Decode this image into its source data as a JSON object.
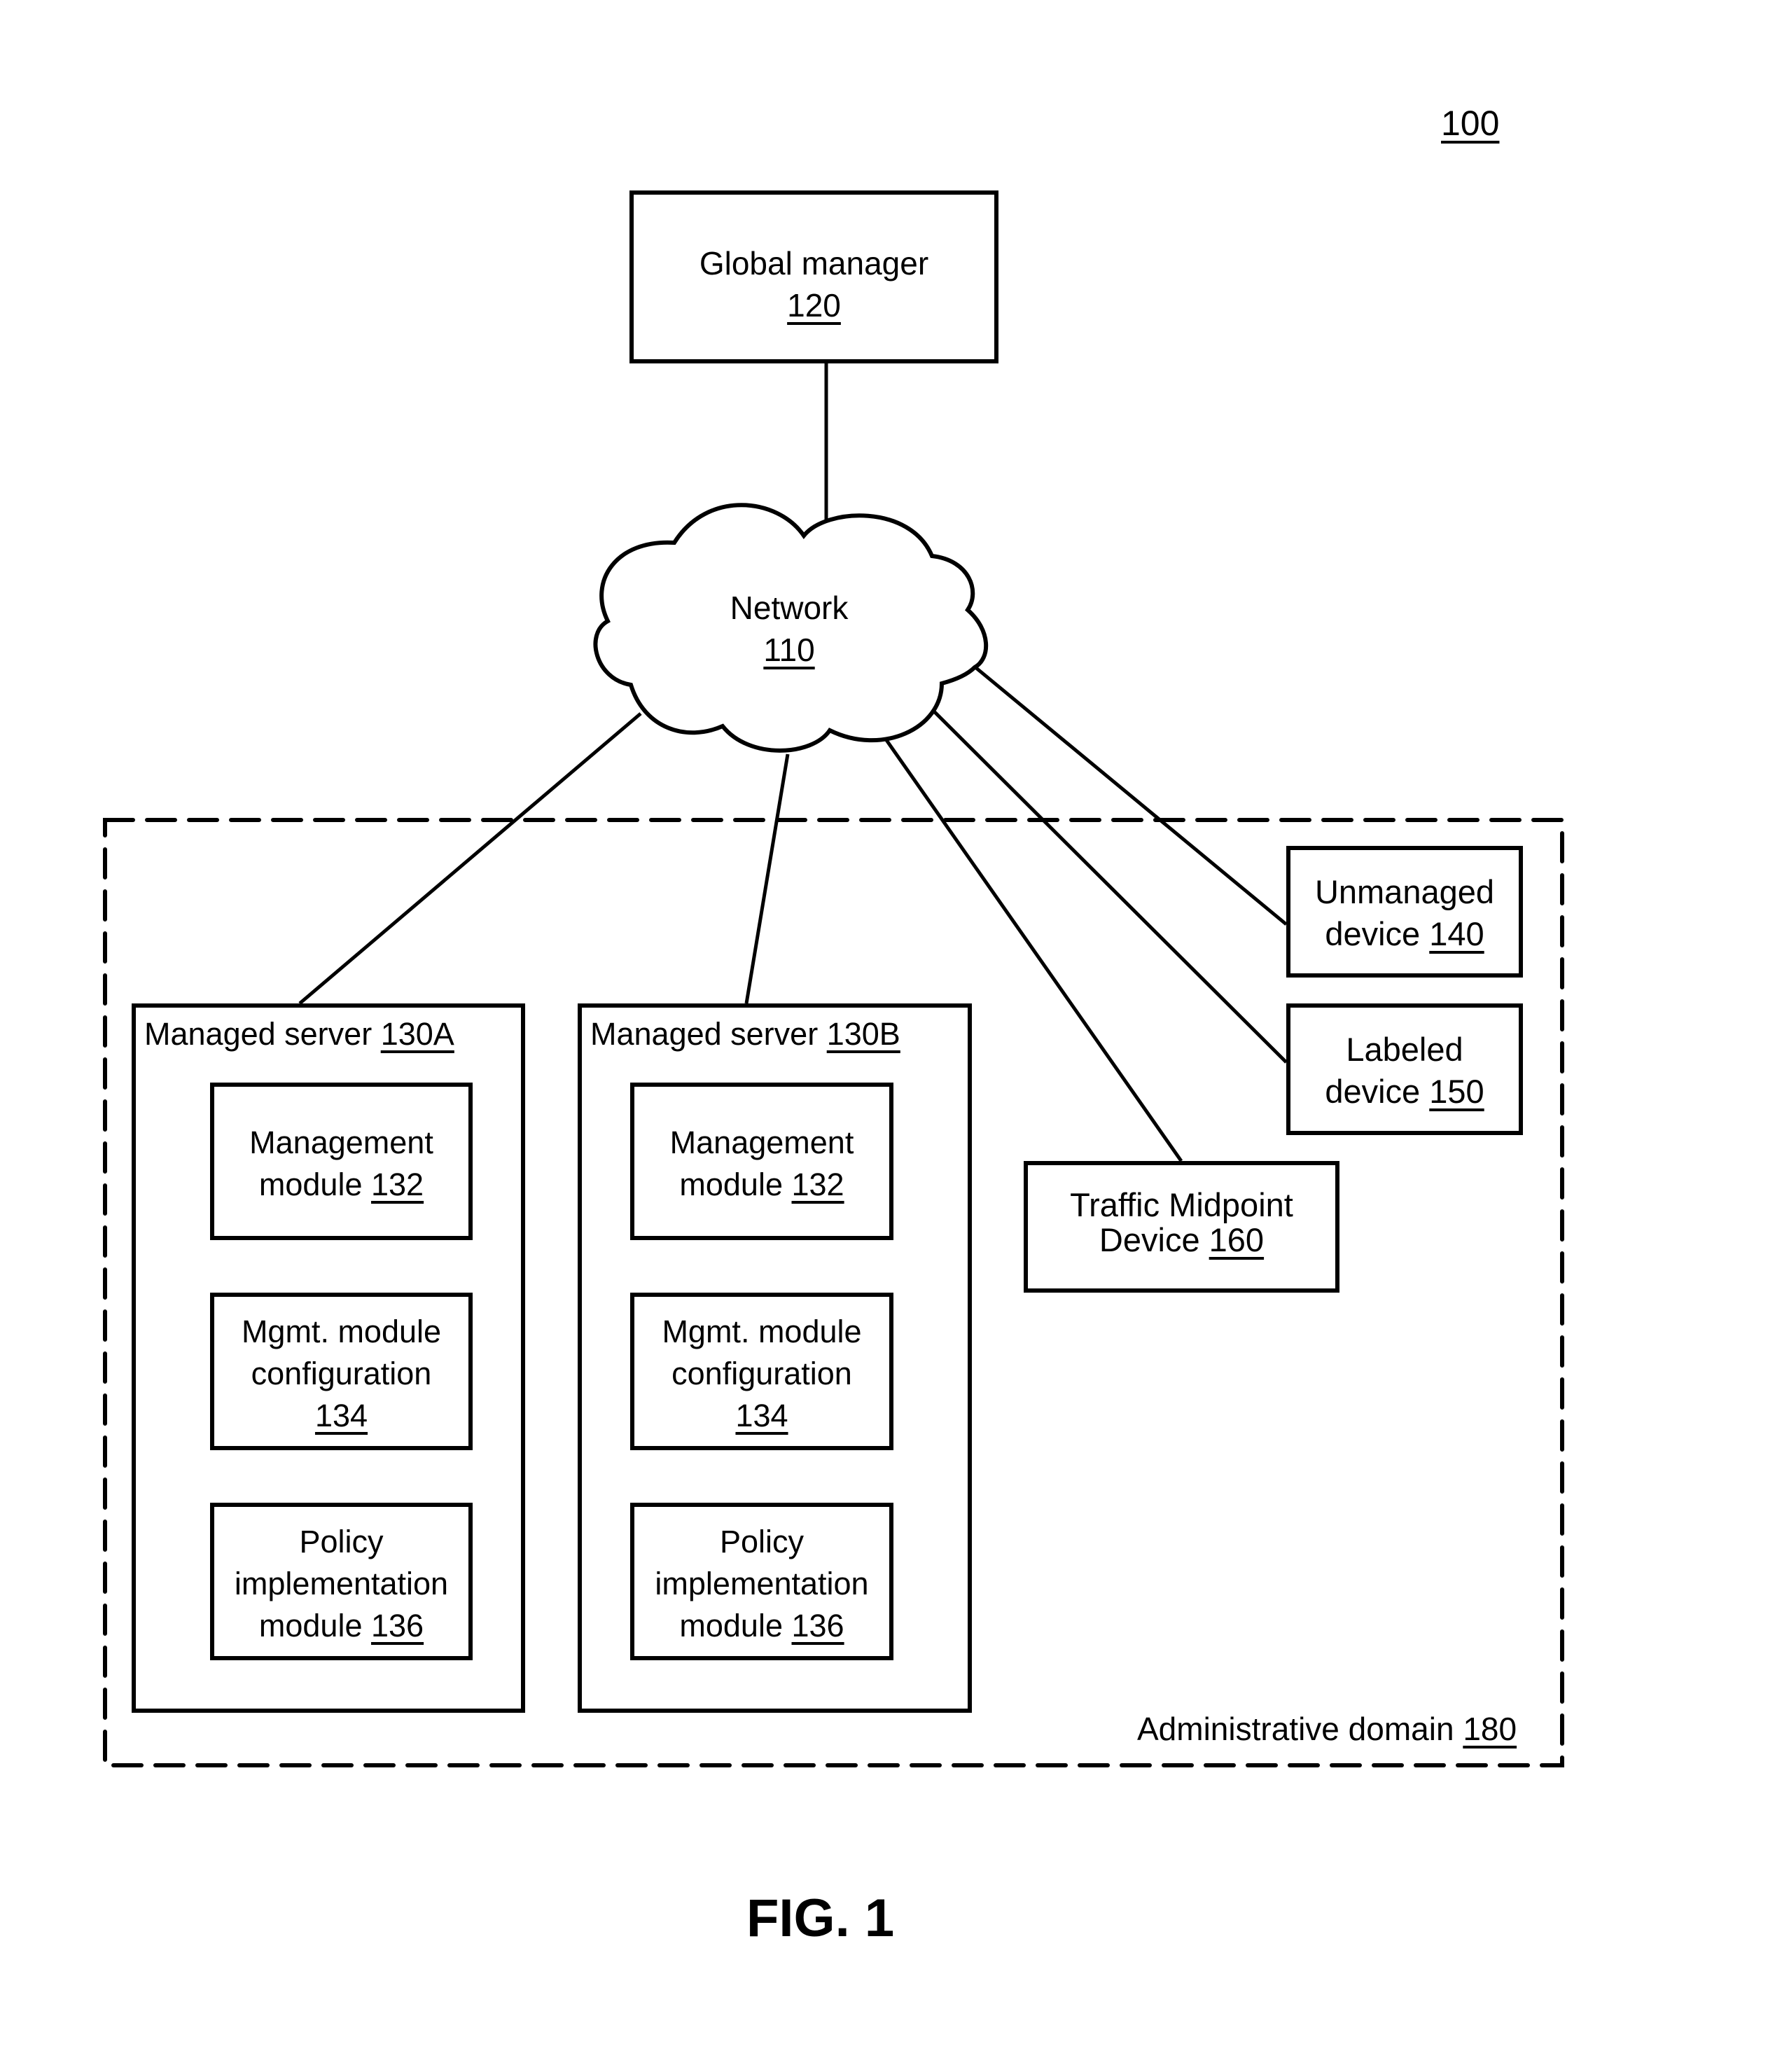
{
  "figure": {
    "reference": "100",
    "caption": "FIG. 1"
  },
  "global_manager": {
    "title": "Global manager",
    "ref": "120"
  },
  "network": {
    "title": "Network",
    "ref": "110"
  },
  "administrative_domain": {
    "title": "Administrative domain",
    "ref": "180"
  },
  "servers": [
    {
      "title": "Managed server",
      "ref": "130A",
      "modules": [
        {
          "lines": [
            "Management"
          ],
          "last_prefix": "module",
          "ref": "132"
        },
        {
          "lines": [
            "Mgmt. module",
            "configuration"
          ],
          "last_prefix": "",
          "ref": "134"
        },
        {
          "lines": [
            "Policy",
            "implementation"
          ],
          "last_prefix": "module",
          "ref": "136"
        }
      ]
    },
    {
      "title": "Managed server",
      "ref": "130B",
      "modules": [
        {
          "lines": [
            "Management"
          ],
          "last_prefix": "module",
          "ref": "132"
        },
        {
          "lines": [
            "Mgmt. module",
            "configuration"
          ],
          "last_prefix": "",
          "ref": "134"
        },
        {
          "lines": [
            "Policy",
            "implementation"
          ],
          "last_prefix": "module",
          "ref": "136"
        }
      ]
    }
  ],
  "devices": {
    "unmanaged": {
      "line1": "Unmanaged",
      "prefix": "device",
      "ref": "140"
    },
    "labeled": {
      "line1": "Labeled",
      "prefix": "device",
      "ref": "150"
    },
    "traffic_midpoint": {
      "line1": "Traffic Midpoint",
      "prefix": "Device",
      "ref": "160"
    }
  },
  "connections": [
    {
      "from": "network",
      "to": "global_manager"
    },
    {
      "from": "network",
      "to": "managed_server_130A"
    },
    {
      "from": "network",
      "to": "managed_server_130B"
    },
    {
      "from": "network",
      "to": "traffic_midpoint_device_160"
    },
    {
      "from": "network",
      "to": "labeled_device_150"
    },
    {
      "from": "network",
      "to": "unmanaged_device_140"
    }
  ]
}
